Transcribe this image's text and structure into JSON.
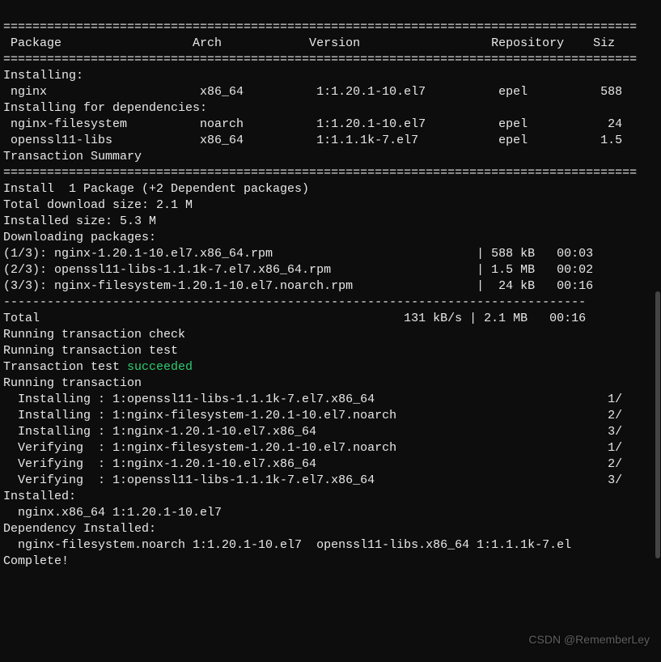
{
  "headers": {
    "package": "Package",
    "arch": "Arch",
    "version": "Version",
    "repository": "Repository",
    "size": "Siz"
  },
  "sections": {
    "installing": "Installing:",
    "installing_deps": "Installing for dependencies:",
    "txn_summary": "Transaction Summary",
    "install_count": "Install  1 Package (+2 Dependent packages)",
    "total_download": "Total download size: 2.1 M",
    "installed_size": "Installed size: 5.3 M",
    "downloading": "Downloading packages:",
    "total": "Total",
    "total_rate": "131 kB/s |",
    "total_size": "2.1 MB",
    "total_time": "00:16",
    "running_check": "Running transaction check",
    "running_test": "Running transaction test",
    "txn_test": "Transaction test ",
    "succeeded": "succeeded",
    "running_txn": "Running transaction",
    "installed": "Installed:",
    "dep_installed": "Dependency Installed:",
    "complete": "Complete!"
  },
  "packages": [
    {
      "name": "nginx",
      "arch": "x86_64",
      "version": "1:1.20.1-10.el7",
      "repo": "epel",
      "size": "588"
    },
    {
      "name": "nginx-filesystem",
      "arch": "noarch",
      "version": "1:1.20.1-10.el7",
      "repo": "epel",
      "size": "24"
    },
    {
      "name": "openssl11-libs",
      "arch": "x86_64",
      "version": "1:1.1.1k-7.el7",
      "repo": "epel",
      "size": "1.5"
    }
  ],
  "downloads": [
    {
      "idx": "(1/3)",
      "file": "nginx-1.20.1-10.el7.x86_64.rpm",
      "size": "588 kB",
      "time": "00:03"
    },
    {
      "idx": "(2/3)",
      "file": "openssl11-libs-1.1.1k-7.el7.x86_64.rpm",
      "size": "1.5 MB",
      "time": "00:02"
    },
    {
      "idx": "(3/3)",
      "file": "nginx-filesystem-1.20.1-10.el7.noarch.rpm",
      "size": " 24 kB",
      "time": "00:16"
    }
  ],
  "steps": [
    {
      "action": "Installing",
      "pkg": "1:openssl11-libs-1.1.1k-7.el7.x86_64",
      "pos": "1/"
    },
    {
      "action": "Installing",
      "pkg": "1:nginx-filesystem-1.20.1-10.el7.noarch",
      "pos": "2/"
    },
    {
      "action": "Installing",
      "pkg": "1:nginx-1.20.1-10.el7.x86_64",
      "pos": "3/"
    },
    {
      "action": "Verifying ",
      "pkg": "1:nginx-filesystem-1.20.1-10.el7.noarch",
      "pos": "1/"
    },
    {
      "action": "Verifying ",
      "pkg": "1:nginx-1.20.1-10.el7.x86_64",
      "pos": "2/"
    },
    {
      "action": "Verifying ",
      "pkg": "1:openssl11-libs-1.1.1k-7.el7.x86_64",
      "pos": "3/"
    }
  ],
  "installed_list": "  nginx.x86_64 1:1.20.1-10.el7",
  "dep_installed_list": "  nginx-filesystem.noarch 1:1.20.1-10.el7  openssl11-libs.x86_64 1:1.1.1k-7.el",
  "watermark": "CSDN @RememberLey",
  "divider_thick": "================================================================================================",
  "divider_thin": "--------------------------------------------------------------------------------"
}
